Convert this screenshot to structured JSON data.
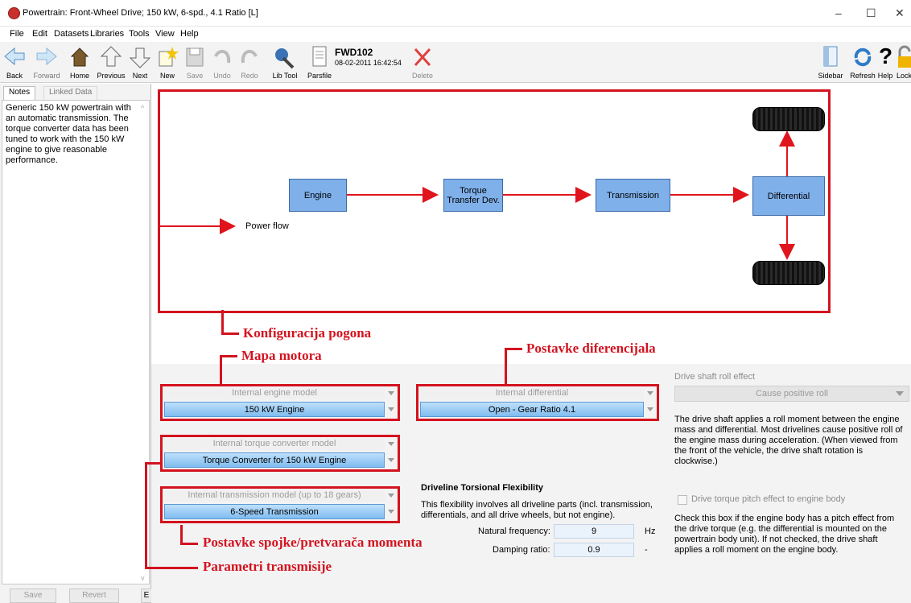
{
  "window": {
    "title": "Powertrain: Front-Wheel Drive;  150 kW, 6-spd., 4.1 Ratio [L]",
    "min": "–",
    "max": "☐",
    "close": "✕"
  },
  "menu": [
    "File",
    "Edit",
    "Datasets",
    "Libraries",
    "Tools",
    "View",
    "Help"
  ],
  "toolbar": {
    "back": "Back",
    "forward": "Forward",
    "home": "Home",
    "previous": "Previous",
    "next": "Next",
    "new": "New",
    "save": "Save",
    "undo": "Undo",
    "redo": "Redo",
    "libtool": "Lib Tool",
    "parsfile": "Parsfile",
    "dataset_name": "FWD102",
    "dataset_date": "08-02-2011 16:42:54",
    "delete": "Delete",
    "sidebar": "Sidebar",
    "refresh": "Refresh",
    "help": "Help",
    "lock": "Lock"
  },
  "sidebar": {
    "tab_notes": "Notes",
    "tab_linked": "Linked Data",
    "notes_text": "Generic 150 kW powertrain with an automatic transmission. The torque converter data has been tuned to work with the 150 kW engine to give reasonable performance.",
    "save_btn": "Save",
    "revert_btn": "Revert",
    "extra_btn": "E"
  },
  "diagram": {
    "engine": "Engine",
    "torque_line1": "Torque",
    "torque_line2": "Transfer Dev.",
    "transmission": "Transmission",
    "differential": "Differential",
    "power_flow": "Power flow"
  },
  "annotations": {
    "konfiguracija": "Konfiguracija pogona",
    "mapa": "Mapa motora",
    "diferencijal": "Postavke diferencijala",
    "spojka": "Postavke spojke/pretvarača momenta",
    "transmisija": "Parametri transmisije"
  },
  "engine_model": {
    "header": "Internal engine model",
    "value": "150 kW Engine"
  },
  "torque_model": {
    "header": "Internal torque converter model",
    "value": "Torque Converter for 150 kW Engine"
  },
  "trans_model": {
    "header": "Internal transmission model (up to 18 gears)",
    "value": "6-Speed Transmission"
  },
  "diff_model": {
    "header": "Internal differential",
    "value": "Open - Gear Ratio 4.1"
  },
  "flex": {
    "title": "Driveline Torsional Flexibility",
    "desc": "This flexibility involves all driveline parts (incl. transmission, differentials, and all drive wheels, but not engine).",
    "natfreq_label": "Natural frequency:",
    "natfreq_value": "9",
    "natfreq_unit": "Hz",
    "damping_label": "Damping ratio:",
    "damping_value": "0.9",
    "damping_unit": "-"
  },
  "rollfx": {
    "title": "Drive shaft roll effect",
    "value": "Cause positive roll",
    "desc": "The drive shaft applies a roll moment between the engine mass and differential.  Most drivelines cause positive roll of the engine mass during acceleration. (When viewed from the front of the vehicle, the drive shaft rotation is clockwise.)",
    "checkbox_label": "Drive torque pitch effect to engine body",
    "check_desc": "Check this box if the engine body has a pitch effect from the drive torque (e.g. the differential is mounted on the powertrain body unit). If not checked, the drive shaft applies a roll moment on the engine body."
  },
  "colors": {
    "annotation_red": "#d3131f",
    "block_blue": "#7fb0ea",
    "combo_blue": "#7fbcf0"
  }
}
